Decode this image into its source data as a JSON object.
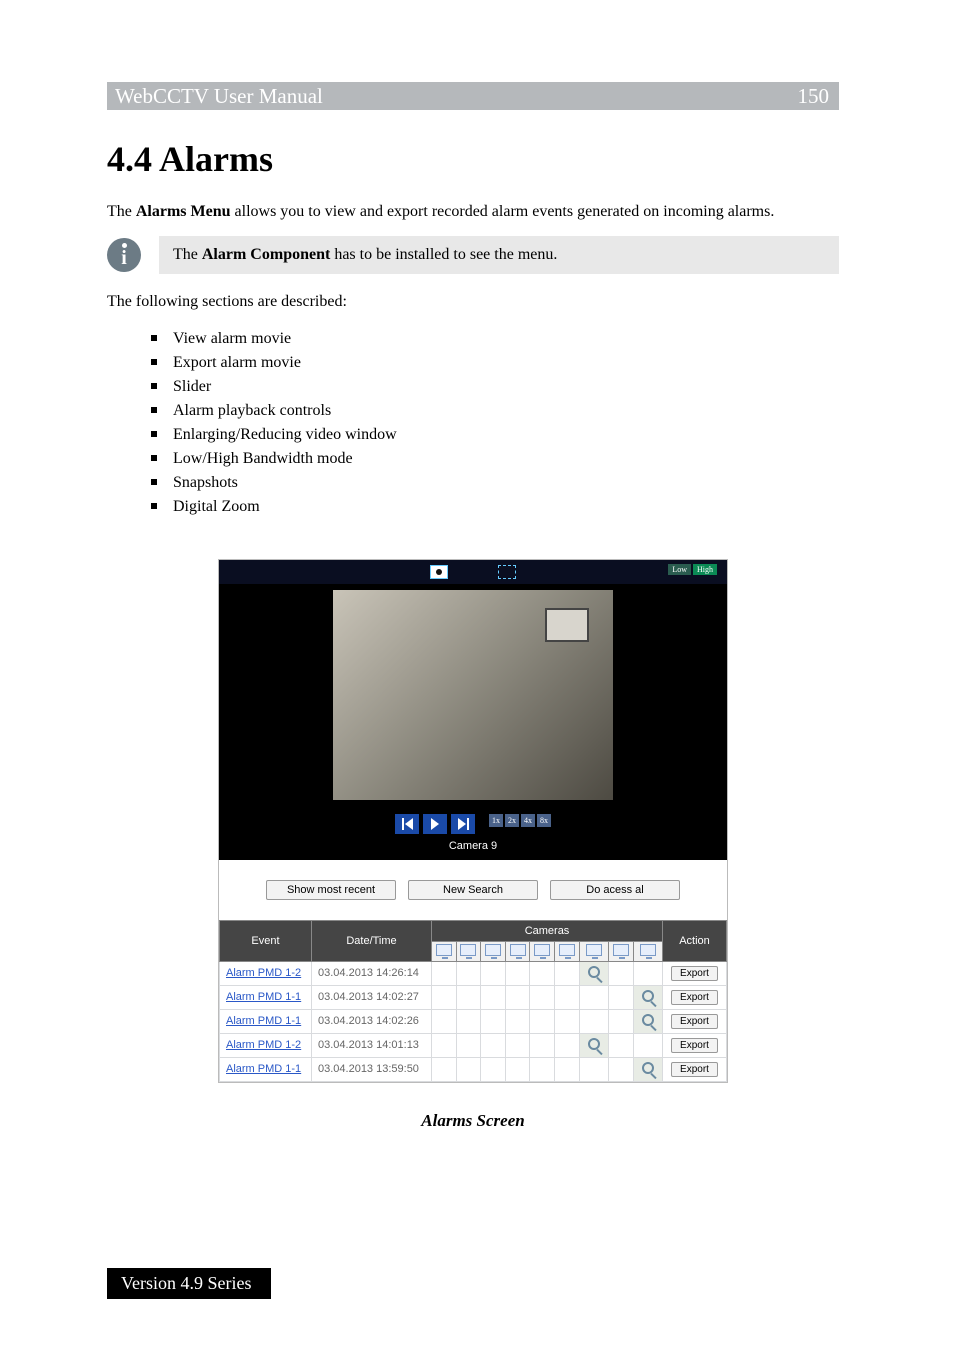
{
  "header": {
    "title": "WebCCTV User Manual",
    "page_number": "150"
  },
  "section": {
    "heading": "4.4 Alarms"
  },
  "intro": {
    "p1_a": "The ",
    "p1_b": "Alarms Menu",
    "p1_c": " allows you to view and export recorded alarm events generated on incoming alarms."
  },
  "callout": {
    "pre": "The ",
    "bold": "Alarm Component",
    "post": " has to be installed to see the menu."
  },
  "desc_line": "The following sections are described:",
  "bullets": [
    "View alarm movie",
    "Export alarm movie",
    "Slider",
    "Alarm playback controls",
    "Enlarging/Reducing video window",
    "Low/High Bandwidth mode",
    "Snapshots",
    "Digital Zoom"
  ],
  "shot": {
    "bw": {
      "low": "Low",
      "high": "High"
    },
    "speed": [
      "1x",
      "2x",
      "4x",
      "8x"
    ],
    "camera_label": "Camera 9",
    "buttons": {
      "recent": "Show most recent",
      "search": "New Search",
      "access": "Do acess al"
    },
    "table": {
      "headers": {
        "event": "Event",
        "datetime": "Date/Time",
        "cameras": "Cameras",
        "action": "Action"
      },
      "export": "Export",
      "cam_cols": 9,
      "rows": [
        {
          "event": "Alarm PMD 1-2",
          "dt": "03.04.2013 14:26:14",
          "mark_col": 6
        },
        {
          "event": "Alarm PMD 1-1",
          "dt": "03.04.2013 14:02:27",
          "mark_col": 8
        },
        {
          "event": "Alarm PMD 1-1",
          "dt": "03.04.2013 14:02:26",
          "mark_col": 8
        },
        {
          "event": "Alarm PMD 1-2",
          "dt": "03.04.2013 14:01:13",
          "mark_col": 6
        },
        {
          "event": "Alarm PMD 1-1",
          "dt": "03.04.2013 13:59:50",
          "mark_col": 8
        }
      ]
    }
  },
  "caption": "Alarms Screen",
  "footer": {
    "version": "Version 4.9 Series"
  }
}
